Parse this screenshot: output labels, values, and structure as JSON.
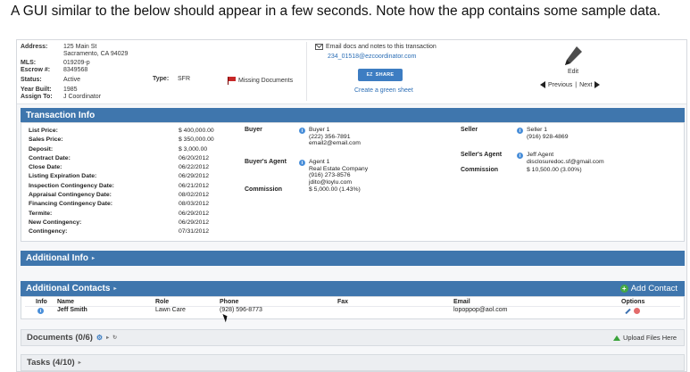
{
  "caption": "A GUI similar to the below should appear in a few seconds. Note how the app contains some sample data.",
  "header": {
    "address_label": "Address:",
    "address_line1": "125 Main St",
    "address_line2": "Sacramento, CA 94029",
    "mls_label": "MLS:",
    "mls": "019209-p",
    "escrow_label": "Escrow #:",
    "escrow": "8349568",
    "status_label": "Status:",
    "status": "Active",
    "year_label": "Year Built:",
    "year": "1985",
    "assign_label": "Assign To:",
    "assign": "J Coordinator",
    "type_label": "Type:",
    "type": "SFR",
    "missing_docs": "Missing Documents",
    "email_docs": "Email docs and notes to this transaction",
    "email_addr": "234_01518@ezcoordinator.com",
    "share_ez": "EZ",
    "share_label": "SHARE",
    "green_sheet": "Create a green sheet",
    "edit": "Edit",
    "previous": "Previous",
    "pipe": "|",
    "next": "Next"
  },
  "transaction": {
    "title": "Transaction Info",
    "labels": [
      "List Price:",
      "Sales Price:",
      "Deposit:",
      "Contract Date:",
      "Close Date:",
      "Listing Expiration Date:",
      "Inspection Contingency Date:",
      "Appraisal Contingency Date:",
      "Financing Contingency Date:",
      "Termite:",
      "New Contingency:",
      "Contingency:"
    ],
    "values": [
      "$ 400,000.00",
      "$ 350,000.00",
      "$ 3,000.00",
      "06/20/2012",
      "06/22/2012",
      "06/29/2012",
      "06/21/2012",
      "08/02/2012",
      "08/03/2012",
      "06/29/2012",
      "06/29/2012",
      "07/31/2012"
    ],
    "buyer_label": "Buyer",
    "buyer_lines": [
      "Buyer 1",
      "(222) 356-7891",
      "email2@email.com"
    ],
    "buyers_agent_label": "Buyer's Agent",
    "buyers_agent_lines": [
      "Agent 1",
      "Real Estate Company",
      "(916) 273-8576",
      "jdito@loylu.com"
    ],
    "commission_label": "Commission",
    "commission": "$ 5,000.00 (1.43%)",
    "seller_label": "Seller",
    "seller_lines": [
      "Seller 1",
      "(916) 928-4869"
    ],
    "sellers_agent_label": "Seller's Agent",
    "sellers_agent_lines": [
      "Jeff Agent",
      "disclosuredoc.sf@gmail.com"
    ],
    "seller_commission_label": "Commission",
    "seller_commission": "$ 10,500.00 (3.00%)"
  },
  "additional_info": {
    "title": "Additional Info"
  },
  "contacts": {
    "title": "Additional Contacts",
    "add": "Add Contact",
    "columns": [
      "Info",
      "Name",
      "Role",
      "Phone",
      "Fax",
      "Email",
      "Options"
    ],
    "row": {
      "name": "Jeff Smith",
      "role": "Lawn Care",
      "phone": "(928) 596-8773",
      "fax": "",
      "email": "lopoppop@aol.com"
    }
  },
  "documents": {
    "title": "Documents (0/6)",
    "upload": "Upload Files Here"
  },
  "tasks": {
    "title": "Tasks (4/10)"
  },
  "colors": {
    "panel_header": "#3f76ad",
    "link": "#2a6db5",
    "accent_green": "#44a844"
  },
  "icons": [
    "envelope-icon",
    "flag-icon",
    "pencil-icon",
    "info-icon",
    "plus-icon",
    "gear-icon",
    "upload-icon",
    "cursor-icon"
  ]
}
